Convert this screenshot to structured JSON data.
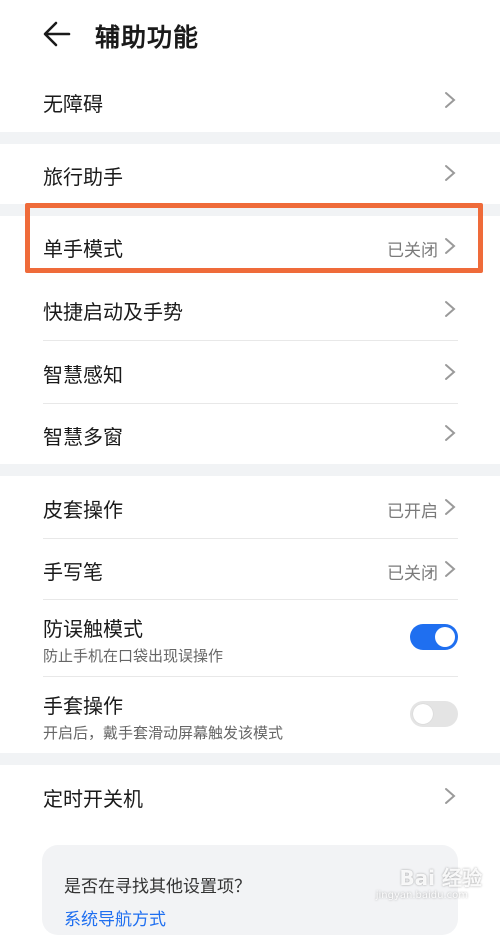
{
  "header": {
    "title": "辅助功能",
    "back_icon": "arrow-left-icon"
  },
  "sections": {
    "s1": {
      "label": "无障碍"
    },
    "s2": {
      "label": "旅行助手"
    },
    "s3": [
      {
        "label": "单手模式",
        "value": "已关闭"
      },
      {
        "label": "快捷启动及手势"
      },
      {
        "label": "智慧感知"
      },
      {
        "label": "智慧多窗"
      }
    ],
    "s4": [
      {
        "label": "皮套操作",
        "value": "已开启"
      },
      {
        "label": "手写笔",
        "value": "已关闭"
      },
      {
        "label": "防误触模式",
        "subtitle": "防止手机在口袋出现误操作",
        "toggle": true
      },
      {
        "label": "手套操作",
        "subtitle": "开启后，戴手套滑动屏幕触发该模式",
        "toggle": false
      }
    ],
    "s5": {
      "label": "定时开关机"
    }
  },
  "suggestion": {
    "question": "是否在寻找其他设置项？",
    "link": "系统导航方式"
  },
  "watermark": {
    "text": "Bai 经验",
    "sub": "jingyan.baidu.com"
  },
  "colors": {
    "accent": "#1f6ff0",
    "highlight_border": "#ef6b3a",
    "section_gap": "#f1f3f5"
  }
}
